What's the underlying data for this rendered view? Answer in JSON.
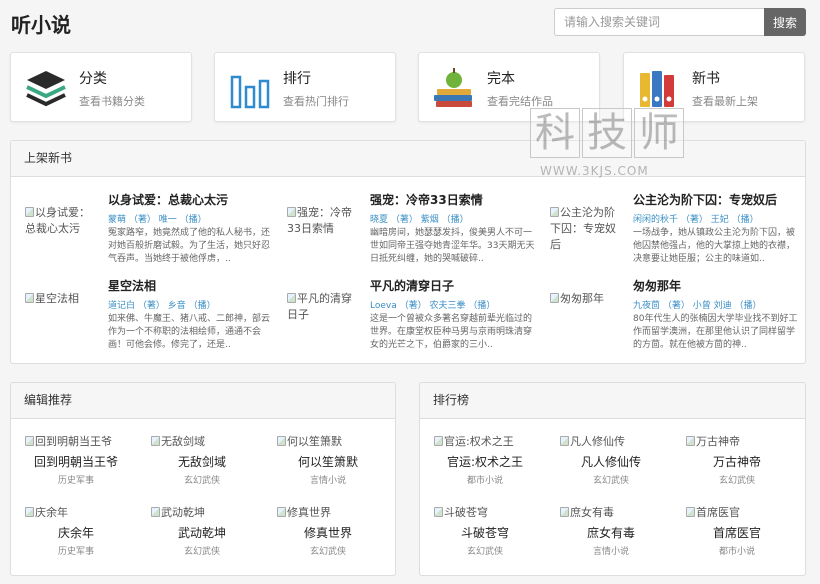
{
  "header": {
    "logo": "听小说",
    "search_placeholder": "请输入搜索关键词",
    "search_button": "搜索"
  },
  "nav_cards": [
    {
      "title": "分类",
      "desc": "查看书籍分类",
      "icon": "layers-icon"
    },
    {
      "title": "排行",
      "desc": "查看热门排行",
      "icon": "bar-chart-icon"
    },
    {
      "title": "完本",
      "desc": "查看完结作品",
      "icon": "books-apple-icon"
    },
    {
      "title": "新书",
      "desc": "查看最新上架",
      "icon": "binders-icon"
    }
  ],
  "new_books": {
    "heading": "上架新书",
    "items": [
      {
        "cover_alt": "以身试爱：总裁心太污",
        "title": "以身试爱：总裁心太污",
        "meta": "蒙萌 （著） 唯一 （播）",
        "desc": "冤家路窄，她竟然成了他的私人秘书，还对她百般折磨试毅。为了生活，她只好忍气吞声。当她终于被他俘虏，.."
      },
      {
        "cover_alt": "强宠：冷帝33日索情",
        "title": "强宠：冷帝33日索情",
        "meta": "晓夏 （著） 紫烟 （播）",
        "desc": "幽暗房间，她瑟瑟发抖，俊美男人不可一世如同帝王强夺她青涩年华。33天期无天日抵死纠缠，她的哭喊破碎.."
      },
      {
        "cover_alt": "公主沦为阶下囚：专宠奴后",
        "title": "公主沦为阶下囚：专宠奴后",
        "meta": "闲闲的秋千 （著） 王妃 （播）",
        "desc": "一场战争，她从镇政公主沦为阶下囚，被他囚禁他强占，他的大掌掠上她的衣襟，决意要让她臣服；公主的味道如.."
      },
      {
        "cover_alt": "星空法相",
        "title": "星空法相",
        "meta": "道记白 （著） 乡音 （播）",
        "desc": "如来佛、牛魔王、猪八戒、二郎神，部云作为一个不称职的法相绘师，通通不会画！可他会修。修完了，还是.."
      },
      {
        "cover_alt": "平凡的清穿日子",
        "title": "平凡的清穿日子",
        "meta": "Loeva （著） 农夫三拳 （播）",
        "desc": "这是一个曾被众多著名穿越前辈光临过的世界。在康堂权臣种马男与京雨明珠清穿女的光芒之下，伯爵家的三小.."
      },
      {
        "cover_alt": "匆匆那年",
        "title": "匆匆那年",
        "meta": "九夜茴 （著） 小曾 刘迪 （播）",
        "desc": "80年代生人的张楠因大学毕业找不到好工作而留学澳洲，在那里他认识了同样留学的方茴。就在他被方茴的神.."
      }
    ]
  },
  "editor_picks": {
    "heading": "编辑推荐",
    "items": [
      {
        "name": "回到明朝当王爷",
        "category": "历史军事"
      },
      {
        "name": "无敌剑域",
        "category": "玄幻武侠"
      },
      {
        "name": "何以笙箫默",
        "category": "言情小说"
      },
      {
        "name": "庆余年",
        "category": "历史军事"
      },
      {
        "name": "武动乾坤",
        "category": "玄幻武侠"
      },
      {
        "name": "修真世界",
        "category": "玄幻武侠"
      }
    ]
  },
  "ranking": {
    "heading": "排行榜",
    "items": [
      {
        "name": "官运:权术之王",
        "category": "都市小说"
      },
      {
        "name": "凡人修仙传",
        "category": "玄幻武侠"
      },
      {
        "name": "万古神帝",
        "category": "玄幻武侠"
      },
      {
        "name": "斗破苍穹",
        "category": "玄幻武侠"
      },
      {
        "name": "庶女有毒",
        "category": "言情小说"
      },
      {
        "name": "首席医官",
        "category": "都市小说"
      }
    ]
  },
  "watermark": {
    "chars": [
      "科",
      "技",
      "师"
    ],
    "url": "WWW.3KJS.COM"
  }
}
